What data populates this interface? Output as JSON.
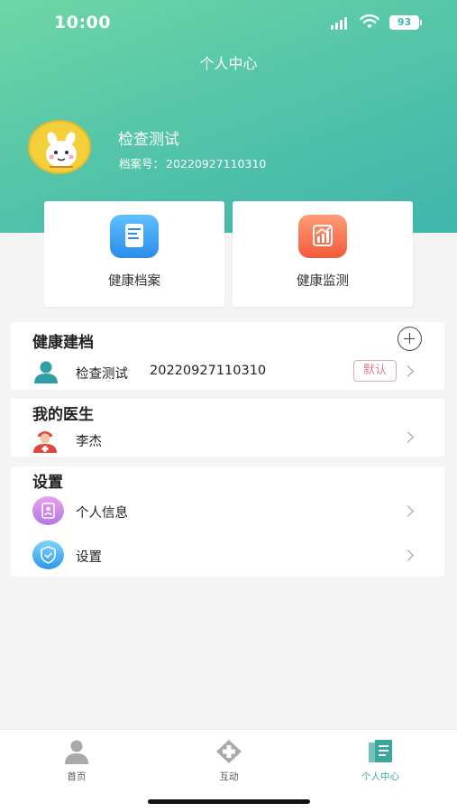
{
  "status_bar": {
    "time": "10:00",
    "battery": "93"
  },
  "nav": {
    "title": "个人中心"
  },
  "profile": {
    "name": "检查测试",
    "record_label": "档案号：",
    "record_number": "20220927110310"
  },
  "quick_actions": [
    {
      "label": "健康档案",
      "icon": "health-file-icon"
    },
    {
      "label": "健康监测",
      "icon": "health-monitor-icon"
    }
  ],
  "health_archive": {
    "title": "健康建档",
    "entry_name": "检查测试",
    "entry_number": "20220927110310",
    "badge": "默认"
  },
  "my_doctor": {
    "title": "我的医生",
    "doctor_name": "李杰"
  },
  "settings": {
    "title": "设置",
    "items": [
      {
        "label": "个人信息",
        "icon": "personal-info-icon"
      },
      {
        "label": "设置",
        "icon": "settings-shield-icon"
      }
    ]
  },
  "tabbar": {
    "items": [
      {
        "label": "首页",
        "icon": "home-person-icon",
        "active": false
      },
      {
        "label": "互动",
        "icon": "interaction-cross-icon",
        "active": false
      },
      {
        "label": "个人中心",
        "icon": "profile-book-icon",
        "active": true
      }
    ]
  },
  "colors": {
    "header_start": "#6fd6a6",
    "header_end": "#3fb5ad",
    "active_tab": "#3aa89f",
    "badge": "#d67e8f"
  }
}
